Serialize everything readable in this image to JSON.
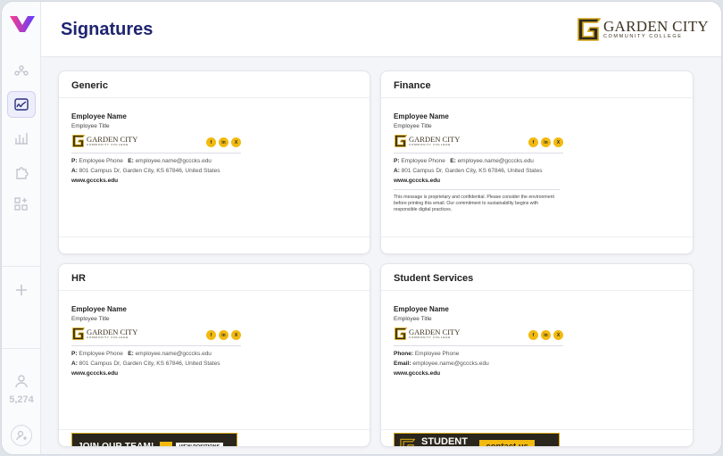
{
  "sidebar": {
    "count": "5,274",
    "icons": [
      "network-icon",
      "signature-icon",
      "chart-icon",
      "puzzle-icon",
      "apps-icon",
      "plus-icon",
      "user-icon",
      "add-user-icon"
    ]
  },
  "header": {
    "title": "Signatures",
    "brand_name": "GARDEN CITY",
    "brand_sub": "COMMUNITY COLLEGE"
  },
  "signature_common": {
    "name": "Employee Name",
    "title": "Employee Title",
    "logo_name": "GARDEN CITY",
    "logo_sub": "COMMUNITY COLLEGE",
    "social_facebook": "f",
    "social_linkedin": "in",
    "social_x": "X",
    "phone_label": "P:",
    "phone_value": "Employee Phone",
    "email_label": "E:",
    "email_value": "employee.name@gcccks.edu",
    "address_label": "A:",
    "address_value": "801 Campus Dr, Garden City, KS 67846, United States",
    "website": "www.gcccks.edu"
  },
  "cards": [
    {
      "title": "Generic"
    },
    {
      "title": "Finance",
      "disclaimer": "This message is proprietary and confidential. Please consider the environment before printing this email. Our commitment to sustainability begins with responsible digital practices."
    },
    {
      "title": "HR",
      "banner_text": "JOIN OUR TEAM!",
      "banner_button": "VIEW POSITIONS"
    },
    {
      "title": "Student Services",
      "phone_label": "Phone:",
      "email_label": "Email:",
      "banner_line1": "STUDENT",
      "banner_line2": "SERVICES",
      "banner_button": "contact us"
    }
  ],
  "colors": {
    "accent": "#1f2470",
    "gold": "#f2b90f",
    "banner_bg": "#2a261d"
  }
}
